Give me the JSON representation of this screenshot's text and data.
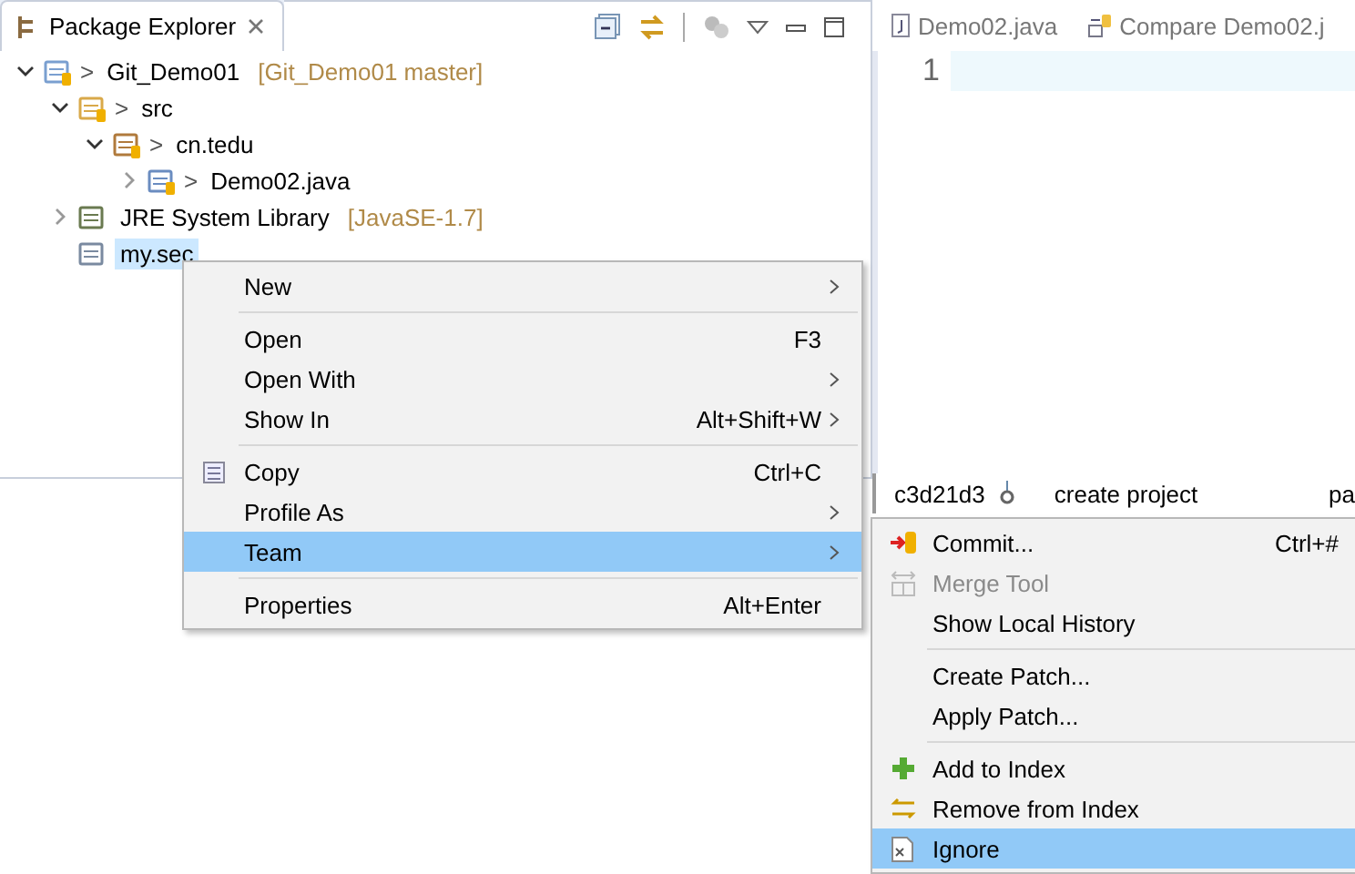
{
  "explorer": {
    "title": "Package Explorer",
    "tree": [
      {
        "kind": "project",
        "git_marker": ">",
        "label": "Git_Demo01",
        "decoration": "[Git_Demo01 master]",
        "expanded": true,
        "selected": false,
        "children": [
          {
            "kind": "sourcefolder",
            "git_marker": ">",
            "label": "src",
            "expanded": true,
            "selected": false,
            "children": [
              {
                "kind": "package",
                "git_marker": ">",
                "label": "cn.tedu",
                "expanded": true,
                "selected": false,
                "children": [
                  {
                    "kind": "javafile",
                    "git_marker": ">",
                    "label": "Demo02.java",
                    "expanded": false,
                    "selected": false
                  }
                ]
              }
            ]
          },
          {
            "kind": "library",
            "label": "JRE System Library",
            "decoration": "[JavaSE-1.7]",
            "expanded": false,
            "selected": false
          },
          {
            "kind": "file",
            "label": "my.sec",
            "selected": true
          }
        ]
      }
    ]
  },
  "editor": {
    "tabs": [
      {
        "kind": "java",
        "label": "Demo02.java",
        "selected": false
      },
      {
        "kind": "compare",
        "label": "Compare Demo02.j",
        "selected": false
      }
    ],
    "line_numbers": [
      "1"
    ]
  },
  "history": {
    "rows": [
      {
        "commit": "c3d21d3",
        "message": "create project",
        "column_3": "pa"
      }
    ]
  },
  "context_menu": {
    "items": [
      {
        "kind": "item",
        "label": "New",
        "submenu": true,
        "selected": false
      },
      {
        "kind": "separator"
      },
      {
        "kind": "item",
        "label": "Open",
        "shortcut": "F3",
        "submenu": false,
        "selected": false
      },
      {
        "kind": "item",
        "label": "Open With",
        "submenu": true,
        "selected": false
      },
      {
        "kind": "item",
        "label": "Show In",
        "shortcut": "Alt+Shift+W",
        "submenu": true,
        "selected": false
      },
      {
        "kind": "separator"
      },
      {
        "kind": "copy",
        "label": "Copy",
        "shortcut": "Ctrl+C",
        "submenu": false,
        "selected": false
      },
      {
        "kind": "item",
        "label": "Profile As",
        "submenu": true,
        "selected": false
      },
      {
        "kind": "item",
        "label": "Team",
        "submenu": true,
        "selected": true
      },
      {
        "kind": "separator"
      },
      {
        "kind": "item",
        "label": "Properties",
        "shortcut": "Alt+Enter",
        "submenu": false,
        "selected": false
      }
    ]
  },
  "team_submenu": {
    "items": [
      {
        "kind": "commit",
        "label": "Commit...",
        "shortcut": "Ctrl+#",
        "disabled": false,
        "selected": false
      },
      {
        "kind": "merge",
        "label": "Merge Tool",
        "disabled": true,
        "selected": false
      },
      {
        "kind": "item",
        "label": "Show Local History",
        "disabled": false,
        "selected": false
      },
      {
        "kind": "separator"
      },
      {
        "kind": "item",
        "label": "Create Patch...",
        "disabled": false,
        "selected": false
      },
      {
        "kind": "item",
        "label": "Apply Patch...",
        "disabled": false,
        "selected": false
      },
      {
        "kind": "separator"
      },
      {
        "kind": "add",
        "label": "Add to Index",
        "disabled": false,
        "selected": false
      },
      {
        "kind": "remove",
        "label": "Remove from Index",
        "disabled": false,
        "selected": false
      },
      {
        "kind": "ignore",
        "label": "Ignore",
        "disabled": false,
        "selected": true
      }
    ]
  }
}
